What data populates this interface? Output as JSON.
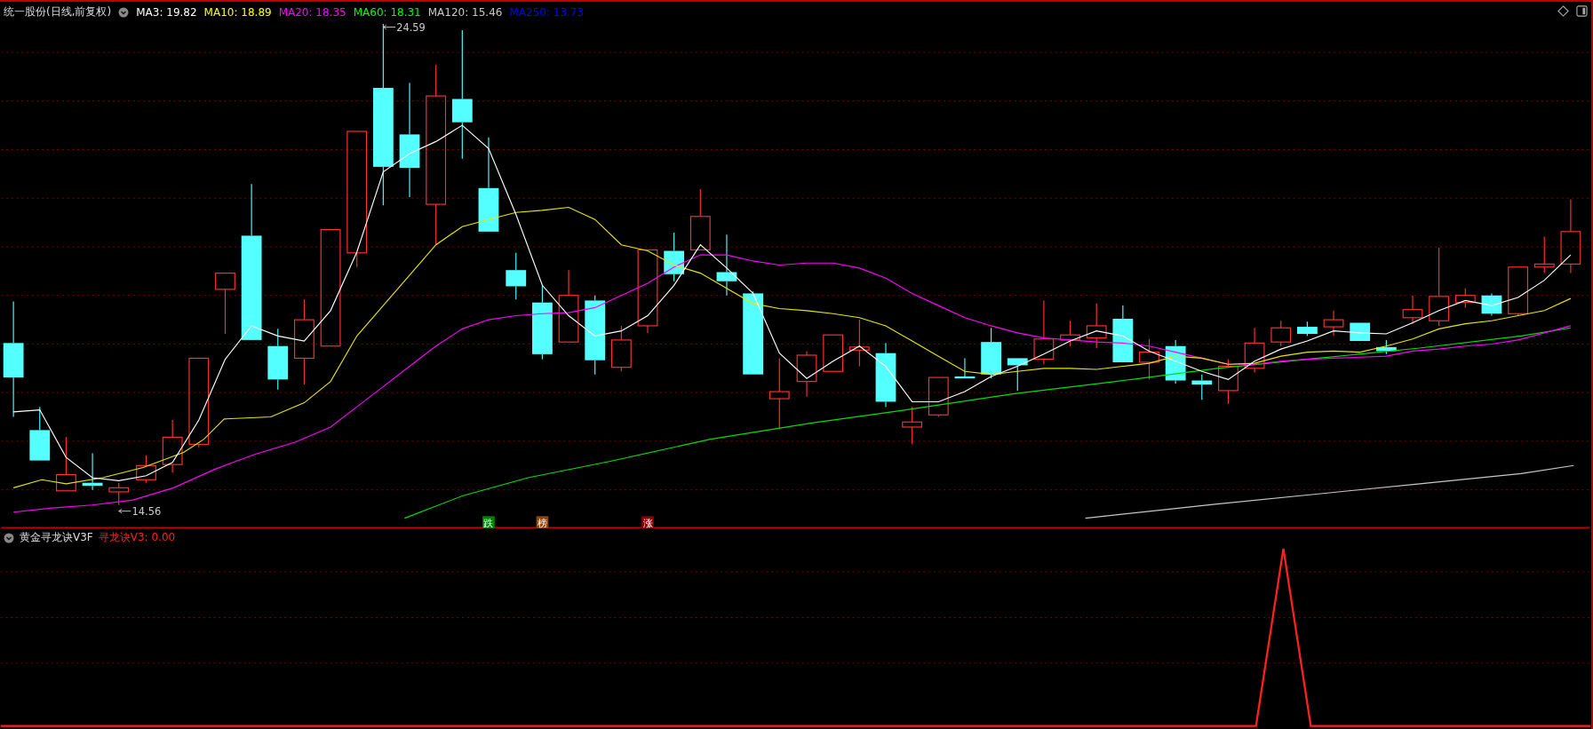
{
  "main_chart": {
    "title": "统一股份(日线,前复权)",
    "ma_legend": [
      {
        "label": "MA3: 19.82",
        "color": "#ffffff"
      },
      {
        "label": "MA10: 18.89",
        "color": "#ffff00"
      },
      {
        "label": "MA20: 18.35",
        "color": "#ff00ff"
      },
      {
        "label": "MA60: 18.31",
        "color": "#00ff00"
      },
      {
        "label": "MA120: 15.46",
        "color": "#c8c8c8"
      },
      {
        "label": "MA250: 13.73",
        "color": "#0000ff"
      }
    ],
    "price_labels": [
      {
        "kind": "high",
        "text": "24.59"
      },
      {
        "kind": "low",
        "text": "14.56"
      }
    ],
    "signals": [
      {
        "text": "跌",
        "color": "#008000"
      },
      {
        "text": "榜",
        "color": "#8b4513"
      },
      {
        "text": "涨",
        "color": "#8b0000"
      }
    ]
  },
  "indicator": {
    "title": "黄金寻龙诀V3F",
    "value_label": "寻龙诀V3: 0.00"
  }
}
